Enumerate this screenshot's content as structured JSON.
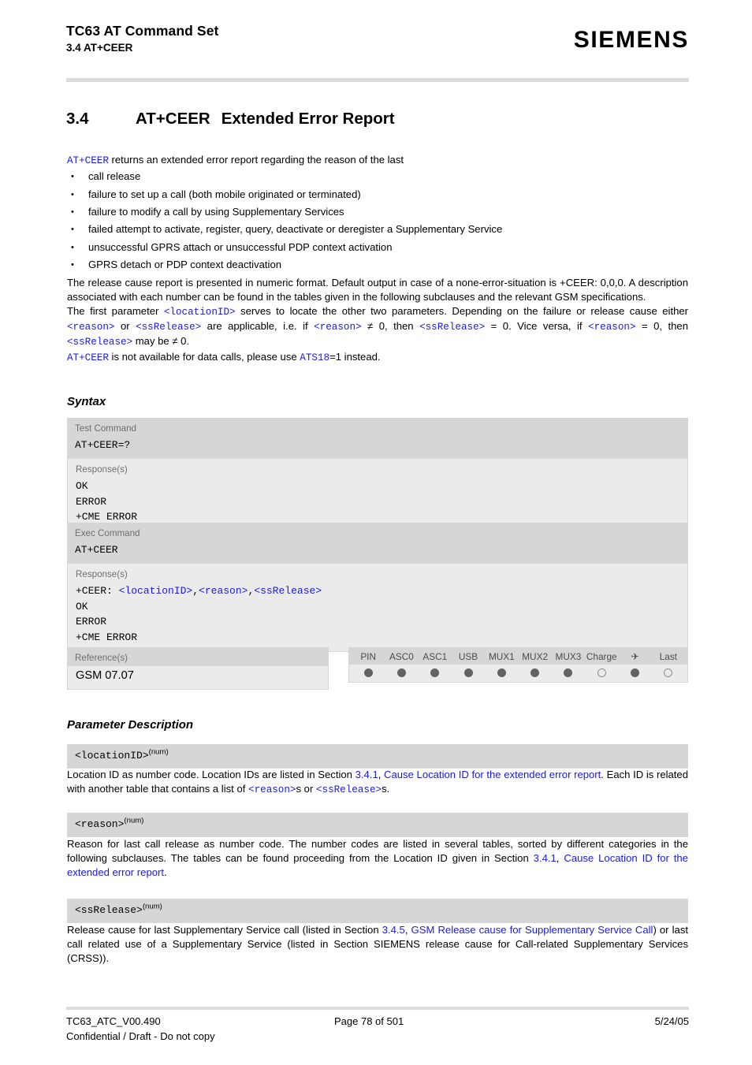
{
  "header": {
    "title": "TC63 AT Command Set",
    "subtitle": "3.4 AT+CEER",
    "logo": "SIEMENS"
  },
  "section": {
    "number": "3.4",
    "command": "AT+CEER",
    "title": "Extended Error Report"
  },
  "intro": {
    "lead_code": "AT+CEER",
    "lead_text": " returns an extended error report regarding the reason of the last",
    "bullets": [
      "call release",
      "failure to set up a call (both mobile originated or terminated)",
      "failure to modify a call by using Supplementary Services",
      "failed attempt to activate, register, query, deactivate or deregister a Supplementary Service",
      "unsuccessful GPRS attach or unsuccessful PDP context activation",
      "GPRS detach or PDP context deactivation"
    ],
    "para1": "The release cause report is presented in numeric format. Default output in case of a none-error-situation is +CEER: 0,0,0. A description associated with each number can be found in the tables given in the following subclauses and the relevant GSM specifications.",
    "para2_a": "The first parameter ",
    "para2_locationid": "<locationID>",
    "para2_b": " serves to locate the other two parameters. Depending on the failure or release cause either ",
    "para2_reason1": "<reason>",
    "para2_c": " or ",
    "para2_ssrelease1": "<ssRelease>",
    "para2_d": " are applicable, i.e. if ",
    "para2_reason2": "<reason>",
    "para2_e": " ≠ 0, then ",
    "para2_ssrelease2": "<ssRelease>",
    "para2_f": " = 0. Vice versa, if ",
    "para2_reason3": "<reason>",
    "para2_g": " = 0, then ",
    "para2_ssrelease3": "<ssRelease>",
    "para2_h": " may be ≠ 0.",
    "para3_a": "AT+CEER",
    "para3_b": " is not available for data calls, please use ",
    "para3_ats18": "ATS18",
    "para3_c": "=1 instead."
  },
  "syntax": {
    "heading": "Syntax",
    "test": {
      "label": "Test Command",
      "command": "AT+CEER=?",
      "response_label": "Response(s)",
      "responses": [
        "OK",
        "ERROR",
        "+CME ERROR"
      ]
    },
    "exec": {
      "label": "Exec Command",
      "command": "AT+CEER",
      "response_label": "Response(s)",
      "response_prefix": "+CEER: ",
      "response_params": [
        "<locationID>",
        "<reason>",
        "<ssRelease>"
      ],
      "responses": [
        "OK",
        "ERROR",
        "+CME ERROR"
      ]
    }
  },
  "reference": {
    "label": "Reference(s)",
    "value": "GSM 07.07"
  },
  "capability": {
    "columns": [
      {
        "label": "PIN",
        "state": "on"
      },
      {
        "label": "ASC0",
        "state": "on"
      },
      {
        "label": "ASC1",
        "state": "on"
      },
      {
        "label": "USB",
        "state": "on"
      },
      {
        "label": "MUX1",
        "state": "on"
      },
      {
        "label": "MUX2",
        "state": "on"
      },
      {
        "label": "MUX3",
        "state": "on"
      },
      {
        "label": "Charge",
        "state": "off"
      },
      {
        "label": "✈",
        "state": "on",
        "icon": "airplane-icon"
      },
      {
        "label": "Last",
        "state": "off"
      }
    ]
  },
  "parameters": {
    "heading": "Parameter Description",
    "items": [
      {
        "name": "<locationID>",
        "sup": "(num)",
        "text_a": "Location ID as number code. Location IDs are listed in Section ",
        "link1": "3.4.1",
        "text_b": ", ",
        "link2": "Cause Location ID for the extended error report",
        "text_c": ". Each ID is related with another table that contains a list of ",
        "code1": "<reason>",
        "text_d": "s or ",
        "code2": "<ssRelease>",
        "text_e": "s."
      },
      {
        "name": "<reason>",
        "sup": "(num)",
        "text_a": "Reason for last call release as number code. The number codes are listed in several tables, sorted by different categories in the following subclauses. The tables can be found proceeding from the Location ID given in Section ",
        "link1": "3.4.1",
        "text_b": ", ",
        "link2": "Cause Location ID for the extended error report",
        "text_c": "."
      },
      {
        "name": "<ssRelease>",
        "sup": "(num)",
        "text_a": "Release cause for last Supplementary Service call (listed in Section ",
        "link1": "3.4.5",
        "text_b": ", ",
        "link2": "GSM Release cause for Supplementary Service Call",
        "text_c": ") or last call related use of a Supplementary Service (listed in Section SIEMENS release cause for Call-related Supplementary Services (CRSS))."
      }
    ]
  },
  "footer": {
    "doc_id": "TC63_ATC_V00.490",
    "page": "Page 78 of 501",
    "date": "5/24/05",
    "confidential": "Confidential / Draft - Do not copy"
  },
  "colors": {
    "link": "#1a1ae0",
    "panel_dark": "#d6d6d6",
    "panel_light": "#ebebeb",
    "rule": "#dcdcdc"
  }
}
